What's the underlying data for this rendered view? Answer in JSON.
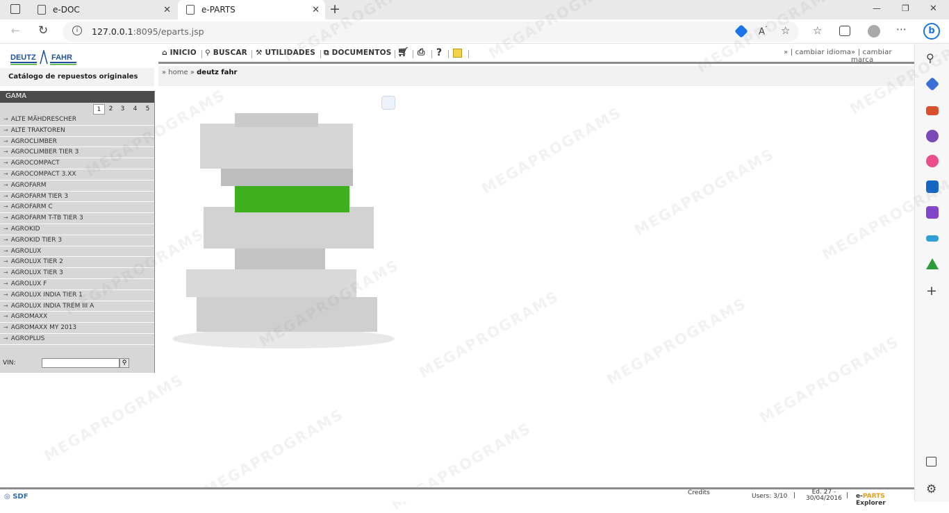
{
  "tabs": [
    {
      "label": "e-DOC",
      "close": "✕"
    },
    {
      "label": "e-PARTS",
      "close": "✕"
    }
  ],
  "new_tab": "+",
  "window_controls": {
    "minimize": "—",
    "maximize": "❐",
    "close": "✕"
  },
  "address": {
    "host": "127.0.0.1",
    "path": ":8095/eparts.jsp"
  },
  "logo": {
    "left": "DEUTZ",
    "right": "FAHR"
  },
  "catalog_title": "Catálogo de repuestos originales",
  "nav": {
    "inicio": "INICIO",
    "buscar": "BUSCAR",
    "utilidades": "UTILIDADES",
    "documentos": "DOCUMENTOS",
    "help": "?",
    "idioma": "cambiar idioma",
    "marca": "cambiar marca"
  },
  "breadcrumb": {
    "home": "home",
    "current": "deutz fahr"
  },
  "gama": {
    "title": "GAMA",
    "pages": [
      "1",
      "2",
      "3",
      "4",
      "5"
    ],
    "active_page": "1",
    "items": [
      "ALTE MÄHDRESCHER",
      "ALTE TRAKTOREN",
      "AGROCLIMBER",
      "AGROCLIMBER TIER 3",
      "AGROCOMPACT",
      "AGROCOMPACT 3.XX",
      "AGROFARM",
      "AGROFARM TIER 3",
      "AGROFARM C",
      "AGROFARM T-TB TIER 3",
      "AGROKID",
      "AGROKID TIER 3",
      "AGROLUX",
      "AGROLUX TIER 2",
      "AGROLUX TIER 3",
      "AGROLUX F",
      "AGROLUX INDIA TIER 1",
      "AGROLUX INDIA TREM III A",
      "AGROMAXX",
      "AGROMAXX MY 2013",
      "AGROPLUS"
    ],
    "vin_label": "VIN:"
  },
  "status": {
    "sdf": "SDF",
    "credits": "Credits",
    "users": "Users: 3/10",
    "edition_line1": "Ed. 27 -",
    "edition_line2": "30/04/2016",
    "brand_e": "e-",
    "brand_parts": "PARTS",
    "brand_explorer": "Explorer"
  },
  "watermark": "MEGAPROGRAMS",
  "colors": {
    "accent_green": "#3fae1f",
    "header_dark": "#4b4b4b",
    "logo_blue": "#1f4f9c"
  }
}
